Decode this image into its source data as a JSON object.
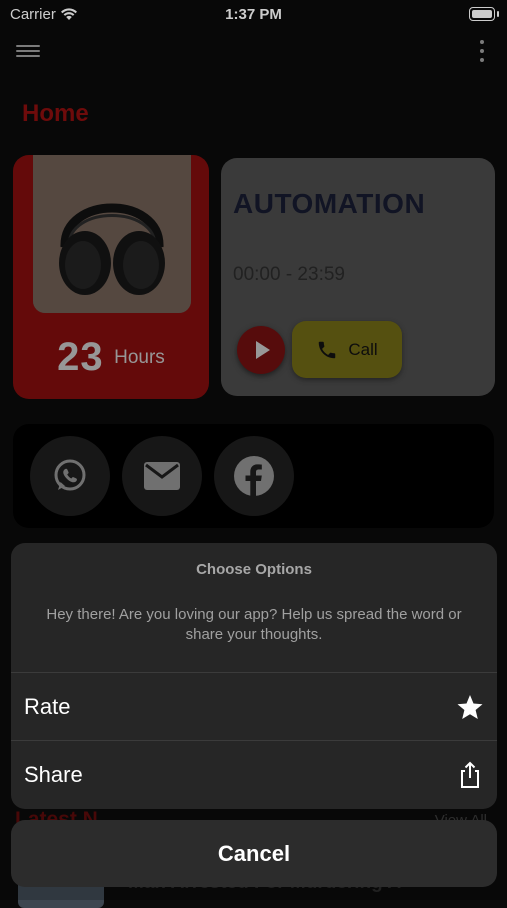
{
  "status_bar": {
    "carrier": "Carrier",
    "time": "1:37 PM"
  },
  "header": {
    "title": "Home"
  },
  "product_card": {
    "hours_value": "23",
    "hours_unit": "Hours"
  },
  "automation_card": {
    "title": "AUTOMATION",
    "time_range": "00:00 - 23:59",
    "call_label": "Call"
  },
  "social": {
    "items": [
      "whatsapp-icon",
      "mail-icon",
      "facebook-icon"
    ]
  },
  "latest_news": {
    "heading": "Latest N",
    "view_all": "View All",
    "first_title": "Man Arrested For Murdering A"
  },
  "action_sheet": {
    "title": "Choose Options",
    "message": "Hey there! Are you loving our app? Help us spread the word or share your thoughts.",
    "options": [
      {
        "label": "Rate",
        "icon": "star-icon"
      },
      {
        "label": "Share",
        "icon": "share-icon"
      }
    ],
    "cancel_label": "Cancel"
  },
  "colors": {
    "accent_red": "#c40a0a",
    "call_yellow": "#d8c92a",
    "sheet_bg": "#262626"
  }
}
